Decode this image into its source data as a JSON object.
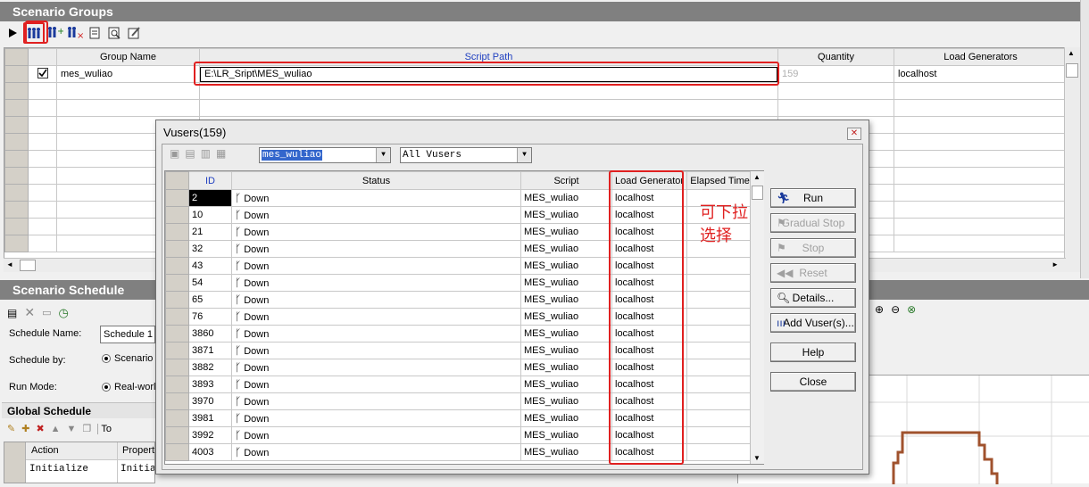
{
  "groups_panel": {
    "title": "Scenario Groups",
    "columns": [
      "Group Name",
      "Script Path",
      "Quantity",
      "Load Generators"
    ],
    "row": {
      "group_name": "mes_wuliao",
      "script_path": "E:\\LR_Sript\\MES_wuliao",
      "quantity": "159",
      "load_generator": "localhost"
    }
  },
  "schedule_panel": {
    "title": "Scenario Schedule",
    "schedule_name_label": "Schedule Name:",
    "schedule_name_value": "Schedule 1",
    "schedule_by_label": "Schedule by:",
    "schedule_by_value": "Scenario",
    "run_mode_label": "Run Mode:",
    "run_mode_value": "Real-world",
    "global_schedule_title": "Global Schedule",
    "global_toolbar_text": "To",
    "columns": [
      "Action",
      "Properties"
    ],
    "row": {
      "action": "Initialize",
      "properties": "Initial"
    }
  },
  "vusers_dialog": {
    "title": "Vusers(159)",
    "group_filter": "mes_wuliao",
    "vuser_filter": "All Vusers",
    "columns": [
      "ID",
      "Status",
      "Script",
      "Load Generator",
      "Elapsed Time"
    ],
    "rows": [
      {
        "id": "2",
        "status": "Down",
        "script": "MES_wuliao",
        "lg": "localhost"
      },
      {
        "id": "10",
        "status": "Down",
        "script": "MES_wuliao",
        "lg": "localhost"
      },
      {
        "id": "21",
        "status": "Down",
        "script": "MES_wuliao",
        "lg": "localhost"
      },
      {
        "id": "32",
        "status": "Down",
        "script": "MES_wuliao",
        "lg": "localhost"
      },
      {
        "id": "43",
        "status": "Down",
        "script": "MES_wuliao",
        "lg": "localhost"
      },
      {
        "id": "54",
        "status": "Down",
        "script": "MES_wuliao",
        "lg": "localhost"
      },
      {
        "id": "65",
        "status": "Down",
        "script": "MES_wuliao",
        "lg": "localhost"
      },
      {
        "id": "76",
        "status": "Down",
        "script": "MES_wuliao",
        "lg": "localhost"
      },
      {
        "id": "3860",
        "status": "Down",
        "script": "MES_wuliao",
        "lg": "localhost"
      },
      {
        "id": "3871",
        "status": "Down",
        "script": "MES_wuliao",
        "lg": "localhost"
      },
      {
        "id": "3882",
        "status": "Down",
        "script": "MES_wuliao",
        "lg": "localhost"
      },
      {
        "id": "3893",
        "status": "Down",
        "script": "MES_wuliao",
        "lg": "localhost"
      },
      {
        "id": "3970",
        "status": "Down",
        "script": "MES_wuliao",
        "lg": "localhost"
      },
      {
        "id": "3981",
        "status": "Down",
        "script": "MES_wuliao",
        "lg": "localhost"
      },
      {
        "id": "3992",
        "status": "Down",
        "script": "MES_wuliao",
        "lg": "localhost"
      },
      {
        "id": "4003",
        "status": "Down",
        "script": "MES_wuliao",
        "lg": "localhost"
      }
    ],
    "buttons": {
      "run": "Run",
      "gradual_stop": "Gradual Stop",
      "stop": "Stop",
      "reset": "Reset",
      "details": "Details...",
      "add_vusers": "Add Vuser(s)...",
      "help": "Help",
      "close": "Close"
    }
  },
  "annotation": {
    "line1": "可下拉",
    "line2": "选择",
    "color": "#e02020"
  }
}
